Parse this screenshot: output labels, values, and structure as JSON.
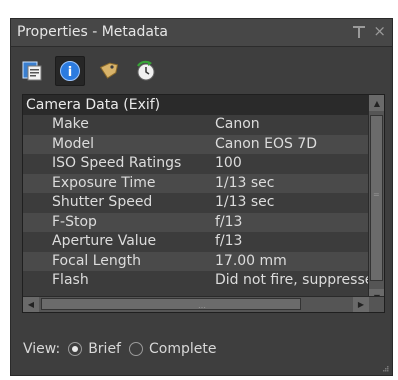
{
  "panel": {
    "title": "Properties - Metadata",
    "close_glyph": "×"
  },
  "toolbar": {
    "buttons": [
      {
        "name": "general-properties-icon"
      },
      {
        "name": "info-metadata-icon",
        "glyph": "i",
        "active": true
      },
      {
        "name": "keyword-tags-icon"
      },
      {
        "name": "history-icon"
      }
    ]
  },
  "metadata": {
    "section": "Camera Data (Exif)",
    "rows": [
      {
        "key": "Make",
        "value": "Canon"
      },
      {
        "key": "Model",
        "value": "Canon EOS 7D"
      },
      {
        "key": "ISO Speed Ratings",
        "value": "100"
      },
      {
        "key": "Exposure Time",
        "value": "1/13 sec"
      },
      {
        "key": "Shutter Speed",
        "value": "1/13 sec"
      },
      {
        "key": "F-Stop",
        "value": "f/13"
      },
      {
        "key": "Aperture Value",
        "value": "f/13"
      },
      {
        "key": "Focal Length",
        "value": "17.00 mm"
      },
      {
        "key": "Flash",
        "value": "Did not fire, suppressed"
      }
    ]
  },
  "view": {
    "label": "View:",
    "options": [
      {
        "label": "Brief",
        "selected": true
      },
      {
        "label": "Complete",
        "selected": false
      }
    ]
  },
  "scroll": {
    "hgrip": "…",
    "vgrip": "="
  }
}
